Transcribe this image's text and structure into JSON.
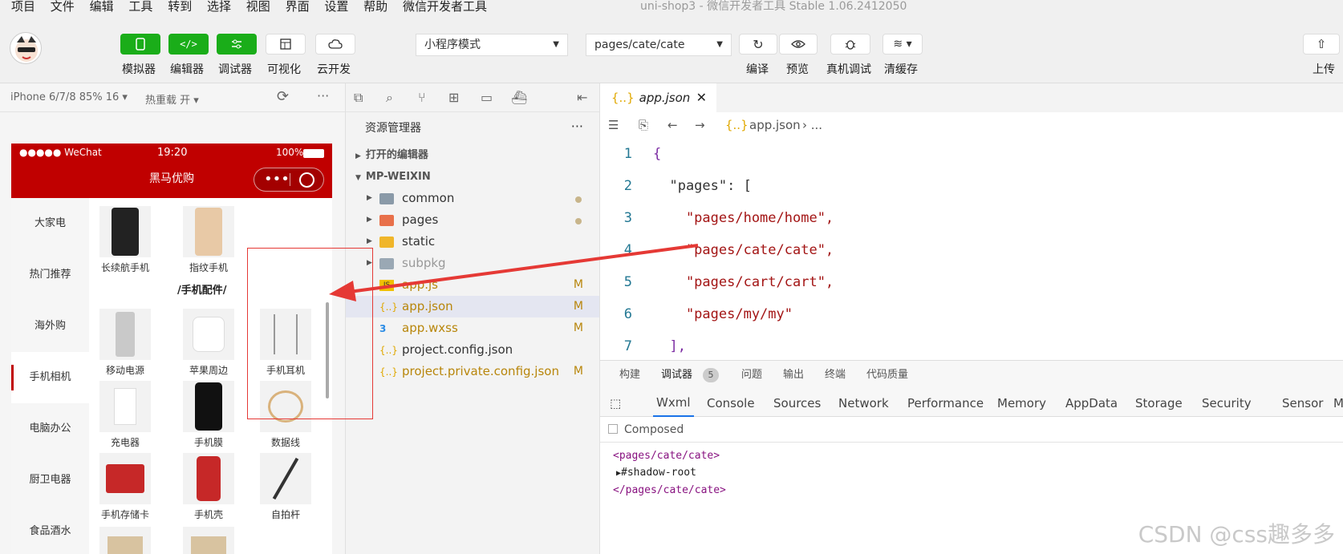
{
  "window_title": "uni-shop3 - 微信开发者工具 Stable 1.06.2412050",
  "menu": [
    "项目",
    "文件",
    "编辑",
    "工具",
    "转到",
    "选择",
    "视图",
    "界面",
    "设置",
    "帮助",
    "微信开发者工具"
  ],
  "toolbar": {
    "simulator": "模拟器",
    "editor": "编辑器",
    "debugger": "调试器",
    "visual": "可视化",
    "cloud": "云开发",
    "mode_select": "小程序模式",
    "page_select": "pages/cate/cate",
    "compile": "编译",
    "preview": "预览",
    "remote_debug": "真机调试",
    "clear_cache": "清缓存",
    "upload": "上传"
  },
  "sim": {
    "device": "iPhone 6/7/8 85% 16 ▾",
    "hot_reload": "热重载 开 ▾",
    "status_left": "●●●●● WeChat",
    "status_time": "19:20",
    "status_battery": "100%",
    "nav_title": "黑马优购",
    "categories": [
      "大家电",
      "热门推荐",
      "海外购",
      "手机相机",
      "电脑办公",
      "厨卫电器",
      "食品酒水"
    ],
    "section_title": "/手机配件/",
    "goods_row0": [
      "长续航手机",
      "指纹手机"
    ],
    "goods_row1": [
      "移动电源",
      "苹果周边",
      "手机耳机"
    ],
    "goods_row2": [
      "充电器",
      "手机膜",
      "数据线"
    ],
    "goods_row3": [
      "手机存储卡",
      "手机壳",
      "自拍杆"
    ]
  },
  "explorer": {
    "title": "资源管理器",
    "more": "···",
    "open_editors": "打开的编辑器",
    "project": "MP-WEIXIN",
    "files": [
      {
        "name": "common",
        "status": ""
      },
      {
        "name": "pages",
        "status": ""
      },
      {
        "name": "static",
        "status": ""
      },
      {
        "name": "subpkg",
        "status": ""
      },
      {
        "name": "app.js",
        "status": "M"
      },
      {
        "name": "app.json",
        "status": "M"
      },
      {
        "name": "app.wxss",
        "status": "M"
      },
      {
        "name": "project.config.json",
        "status": ""
      },
      {
        "name": "project.private.config.json",
        "status": "M"
      }
    ]
  },
  "editor": {
    "tab": "app.json",
    "breadcrumb_file": "app.json",
    "breadcrumb_rest": "› ...",
    "lines": [
      {
        "n": "1",
        "text": "{"
      },
      {
        "n": "2",
        "text": "  \"pages\": ["
      },
      {
        "n": "3",
        "text": "    \"pages/home/home\","
      },
      {
        "n": "4",
        "text": "    \"pages/cate/cate\","
      },
      {
        "n": "5",
        "text": "    \"pages/cart/cart\","
      },
      {
        "n": "6",
        "text": "    \"pages/my/my\""
      },
      {
        "n": "7",
        "text": "  ],"
      }
    ]
  },
  "panel": {
    "tabs": [
      "构建",
      "调试器",
      "问题",
      "输出",
      "终端",
      "代码质量"
    ],
    "debug_count": "5",
    "devtabs": [
      "Wxml",
      "Console",
      "Sources",
      "Network",
      "Performance",
      "Memory",
      "AppData",
      "Storage",
      "Security",
      "Sensor",
      "M"
    ],
    "composed": "Composed",
    "wxml": [
      "<pages/cate/cate>",
      "#shadow-root",
      "</pages/cate/cate>"
    ]
  },
  "watermark": "CSDN @css趣多多"
}
